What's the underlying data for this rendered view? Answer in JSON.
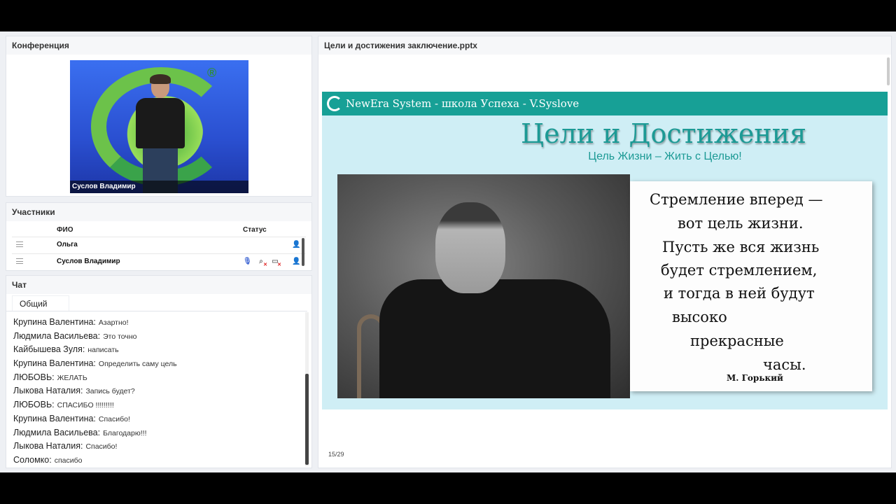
{
  "conference": {
    "title": "Конференция",
    "video_label": "Суслов Владимир"
  },
  "participants": {
    "title": "Участники",
    "col_name": "ФИО",
    "col_status": "Статус",
    "rows": [
      {
        "name": "Ольга"
      },
      {
        "name": "Суслов Владимир"
      }
    ]
  },
  "chat": {
    "title": "Чат",
    "tab": "Общий",
    "messages": [
      {
        "who": "Крупина  Валентина:",
        "text": "Азартно!"
      },
      {
        "who": "Людмила Васильева:",
        "text": "Это точно"
      },
      {
        "who": "Кайбышева Зуля:",
        "text": "написать"
      },
      {
        "who": "Крупина  Валентина:",
        "text": "Определить саму цель"
      },
      {
        "who": "ЛЮБОВЬ:",
        "text": "ЖЕЛАТЬ"
      },
      {
        "who": "Лыкова Наталия:",
        "text": "Запись будет?"
      },
      {
        "who": "ЛЮБОВЬ:",
        "text": "СПАСИБО !!!!!!!!!"
      },
      {
        "who": "Крупина  Валентина:",
        "text": "Спасибо!"
      },
      {
        "who": "Людмила Васильева:",
        "text": "Благодарю!!!"
      },
      {
        "who": "Лыкова Наталия:",
        "text": "Спасибо!"
      },
      {
        "who": "Соломко:",
        "text": "спасибо"
      }
    ]
  },
  "presentation": {
    "title": "Цели и достижения заключение.pptx",
    "page": "15/29",
    "slide": {
      "header": "NewEra System - школа Успеха - V.Syslove",
      "title": "Цели и Достижения",
      "subtitle": "Цель Жизни – Жить с Целью!",
      "quote_lines": [
        "Стремление вперед —",
        "вот цель жизни.",
        "Пусть же вся жизнь",
        "будет стремлением,",
        "и тогда в ней будут",
        "высоко",
        "прекрасные",
        "часы."
      ],
      "author": "М. Горький"
    }
  },
  "colors": {
    "accent_teal": "#17a096",
    "slide_bg": "#cfeef5",
    "panel_bg": "#eef0f4"
  }
}
